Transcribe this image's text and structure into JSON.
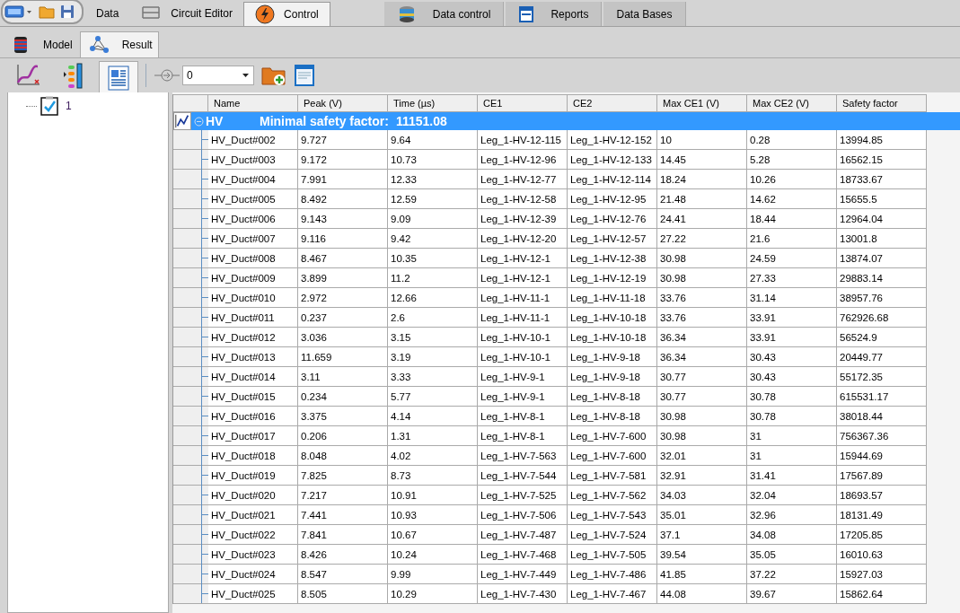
{
  "main_tabs": [
    {
      "label": "Data",
      "selected": false
    },
    {
      "label": "Circuit Editor",
      "selected": false
    },
    {
      "label": "Control",
      "selected": true
    }
  ],
  "module_tabs": [
    {
      "label": "Data control",
      "selected": false
    },
    {
      "label": "Reports",
      "selected": false
    },
    {
      "label": "Data Bases",
      "selected": false
    }
  ],
  "sub_tabs": [
    {
      "label": "Model",
      "selected": false
    },
    {
      "label": "Result",
      "selected": true
    }
  ],
  "toolbar": {
    "views": [
      {
        "selected": false
      },
      {
        "selected": false
      },
      {
        "selected": true
      }
    ],
    "selector": {
      "value": "0"
    }
  },
  "tree": [
    {
      "label": "1",
      "checked": true
    }
  ],
  "table": {
    "columns": [
      "Name",
      "Peak (V)",
      "Time (µs)",
      "CE1",
      "CE2",
      "Max CE1 (V)",
      "Max CE2 (V)",
      "Safety factor"
    ],
    "group": {
      "name": "HV",
      "summary_label": "Minimal safety factor:",
      "summary_value": "11151.08",
      "expanded": true
    },
    "rows": [
      [
        "HV_Duct#002",
        "9.727",
        "9.64",
        "Leg_1-HV-12-115",
        "Leg_1-HV-12-152",
        "10",
        "0.28",
        "13994.85"
      ],
      [
        "HV_Duct#003",
        "9.172",
        "10.73",
        "Leg_1-HV-12-96",
        "Leg_1-HV-12-133",
        "14.45",
        "5.28",
        "16562.15"
      ],
      [
        "HV_Duct#004",
        "7.991",
        "12.33",
        "Leg_1-HV-12-77",
        "Leg_1-HV-12-114",
        "18.24",
        "10.26",
        "18733.67"
      ],
      [
        "HV_Duct#005",
        "8.492",
        "12.59",
        "Leg_1-HV-12-58",
        "Leg_1-HV-12-95",
        "21.48",
        "14.62",
        "15655.5"
      ],
      [
        "HV_Duct#006",
        "9.143",
        "9.09",
        "Leg_1-HV-12-39",
        "Leg_1-HV-12-76",
        "24.41",
        "18.44",
        "12964.04"
      ],
      [
        "HV_Duct#007",
        "9.116",
        "9.42",
        "Leg_1-HV-12-20",
        "Leg_1-HV-12-57",
        "27.22",
        "21.6",
        "13001.8"
      ],
      [
        "HV_Duct#008",
        "8.467",
        "10.35",
        "Leg_1-HV-12-1",
        "Leg_1-HV-12-38",
        "30.98",
        "24.59",
        "13874.07"
      ],
      [
        "HV_Duct#009",
        "3.899",
        "11.2",
        "Leg_1-HV-12-1",
        "Leg_1-HV-12-19",
        "30.98",
        "27.33",
        "29883.14"
      ],
      [
        "HV_Duct#010",
        "2.972",
        "12.66",
        "Leg_1-HV-11-1",
        "Leg_1-HV-11-18",
        "33.76",
        "31.14",
        "38957.76"
      ],
      [
        "HV_Duct#011",
        "0.237",
        "2.6",
        "Leg_1-HV-11-1",
        "Leg_1-HV-10-18",
        "33.76",
        "33.91",
        "762926.68"
      ],
      [
        "HV_Duct#012",
        "3.036",
        "3.15",
        "Leg_1-HV-10-1",
        "Leg_1-HV-10-18",
        "36.34",
        "33.91",
        "56524.9"
      ],
      [
        "HV_Duct#013",
        "11.659",
        "3.19",
        "Leg_1-HV-10-1",
        "Leg_1-HV-9-18",
        "36.34",
        "30.43",
        "20449.77"
      ],
      [
        "HV_Duct#014",
        "3.11",
        "3.33",
        "Leg_1-HV-9-1",
        "Leg_1-HV-9-18",
        "30.77",
        "30.43",
        "55172.35"
      ],
      [
        "HV_Duct#015",
        "0.234",
        "5.77",
        "Leg_1-HV-9-1",
        "Leg_1-HV-8-18",
        "30.77",
        "30.78",
        "615531.17"
      ],
      [
        "HV_Duct#016",
        "3.375",
        "4.14",
        "Leg_1-HV-8-1",
        "Leg_1-HV-8-18",
        "30.98",
        "30.78",
        "38018.44"
      ],
      [
        "HV_Duct#017",
        "0.206",
        "1.31",
        "Leg_1-HV-8-1",
        "Leg_1-HV-7-600",
        "30.98",
        "31",
        "756367.36"
      ],
      [
        "HV_Duct#018",
        "8.048",
        "4.02",
        "Leg_1-HV-7-563",
        "Leg_1-HV-7-600",
        "32.01",
        "31",
        "15944.69"
      ],
      [
        "HV_Duct#019",
        "7.825",
        "8.73",
        "Leg_1-HV-7-544",
        "Leg_1-HV-7-581",
        "32.91",
        "31.41",
        "17567.89"
      ],
      [
        "HV_Duct#020",
        "7.217",
        "10.91",
        "Leg_1-HV-7-525",
        "Leg_1-HV-7-562",
        "34.03",
        "32.04",
        "18693.57"
      ],
      [
        "HV_Duct#021",
        "7.441",
        "10.93",
        "Leg_1-HV-7-506",
        "Leg_1-HV-7-543",
        "35.01",
        "32.96",
        "18131.49"
      ],
      [
        "HV_Duct#022",
        "7.841",
        "10.67",
        "Leg_1-HV-7-487",
        "Leg_1-HV-7-524",
        "37.1",
        "34.08",
        "17205.85"
      ],
      [
        "HV_Duct#023",
        "8.426",
        "10.24",
        "Leg_1-HV-7-468",
        "Leg_1-HV-7-505",
        "39.54",
        "35.05",
        "16010.63"
      ],
      [
        "HV_Duct#024",
        "8.547",
        "9.99",
        "Leg_1-HV-7-449",
        "Leg_1-HV-7-486",
        "41.85",
        "37.22",
        "15927.03"
      ],
      [
        "HV_Duct#025",
        "8.505",
        "10.29",
        "Leg_1-HV-7-430",
        "Leg_1-HV-7-467",
        "44.08",
        "39.67",
        "15862.64"
      ]
    ]
  }
}
